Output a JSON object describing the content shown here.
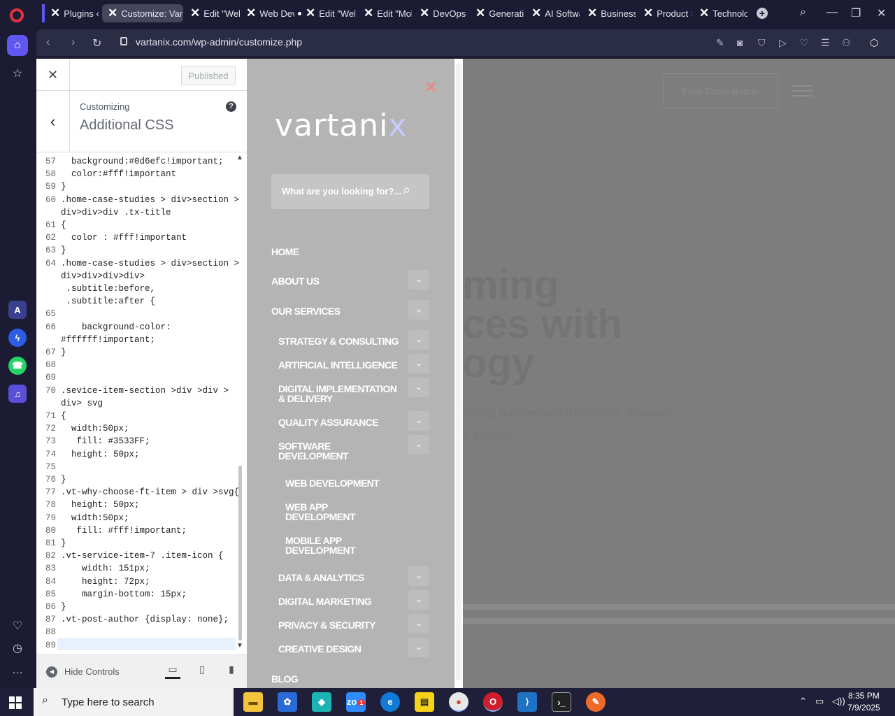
{
  "browser": {
    "tabs": [
      {
        "label": "Plugins ‹",
        "active": false
      },
      {
        "label": "Customize: Varta",
        "active": true
      },
      {
        "label": "Edit \"Web",
        "active": false
      },
      {
        "label": "Web Deve",
        "active": false
      },
      {
        "label": "Edit \"Web",
        "active": false
      },
      {
        "label": "Edit \"Mob",
        "active": false
      },
      {
        "label": "DevOps C",
        "active": false
      },
      {
        "label": "Generativ",
        "active": false
      },
      {
        "label": "AI Softwa",
        "active": false
      },
      {
        "label": "Business",
        "active": false
      },
      {
        "label": "Product S",
        "active": false
      },
      {
        "label": "Technolog",
        "active": false
      }
    ],
    "url": "vartanix.com/wp-admin/customize.php"
  },
  "customizer": {
    "published_label": "Published",
    "customizing_label": "Customizing",
    "section_title": "Additional CSS",
    "hide_controls_label": "Hide Controls",
    "code_lines": [
      {
        "n": "57",
        "t": "  background:#0d6efc!important;"
      },
      {
        "n": "58",
        "t": "  color:#fff!important"
      },
      {
        "n": "59",
        "t": "}"
      },
      {
        "n": "60",
        "t": ".home-case-studies > div>section >"
      },
      {
        "n": "",
        "t": "div>div>div .tx-title"
      },
      {
        "n": "61",
        "t": "{"
      },
      {
        "n": "62",
        "t": "  color : #fff!important"
      },
      {
        "n": "63",
        "t": "}"
      },
      {
        "n": "64",
        "t": ".home-case-studies > div>section >"
      },
      {
        "n": "",
        "t": "div>div>div>div>"
      },
      {
        "n": "",
        "t": " .subtitle:before,"
      },
      {
        "n": "",
        "t": " .subtitle:after {"
      },
      {
        "n": "65",
        "t": ""
      },
      {
        "n": "66",
        "t": "    background-color:"
      },
      {
        "n": "",
        "t": "#ffffff!important;"
      },
      {
        "n": "67",
        "t": "}"
      },
      {
        "n": "68",
        "t": ""
      },
      {
        "n": "69",
        "t": ""
      },
      {
        "n": "70",
        "t": ".sevice-item-section >div >div >"
      },
      {
        "n": "",
        "t": "div> svg"
      },
      {
        "n": "71",
        "t": "{"
      },
      {
        "n": "72",
        "t": "  width:50px;"
      },
      {
        "n": "73",
        "t": "   fill: #3533FF;"
      },
      {
        "n": "74",
        "t": "  height: 50px;"
      },
      {
        "n": "75",
        "t": ""
      },
      {
        "n": "76",
        "t": "}"
      },
      {
        "n": "77",
        "t": ".vt-why-choose-ft-item > div >svg{"
      },
      {
        "n": "78",
        "t": "  height: 50px;"
      },
      {
        "n": "79",
        "t": "  width:50px;"
      },
      {
        "n": "80",
        "t": "   fill: #fff!important;"
      },
      {
        "n": "81",
        "t": "}"
      },
      {
        "n": "82",
        "t": ".vt-service-item-7 .item-icon {"
      },
      {
        "n": "83",
        "t": "    width: 151px;"
      },
      {
        "n": "84",
        "t": "    height: 72px;"
      },
      {
        "n": "85",
        "t": "    margin-bottom: 15px;"
      },
      {
        "n": "86",
        "t": "}"
      },
      {
        "n": "87",
        "t": ".vt-post-author {display: none};"
      },
      {
        "n": "88",
        "t": ""
      },
      {
        "n": "89",
        "t": ""
      }
    ]
  },
  "preview": {
    "logo_main": "vartani",
    "logo_accent": "x",
    "search_placeholder": "What are you looking for?...",
    "free_consult_label": "Free Consultation",
    "hero_line1": "ming",
    "hero_line2": "ces with",
    "hero_line3": "ogy",
    "hero_sub1": "elping businesses transform, innovate",
    "hero_sub2": "e change.",
    "menu": [
      {
        "label": "HOME",
        "level": 0,
        "chevron": false
      },
      {
        "label": "ABOUT US",
        "level": 0,
        "chevron": true
      },
      {
        "label": "OUR SERVICES",
        "level": 0,
        "chevron": true
      },
      {
        "label": "STRATEGY & CONSULTING",
        "level": 1,
        "chevron": true
      },
      {
        "label": "ARTIFICIAL INTELLIGENCE",
        "level": 1,
        "chevron": true
      },
      {
        "label": "DIGITAL IMPLEMENTATION & DELIVERY",
        "level": 1,
        "chevron": true
      },
      {
        "label": "QUALITY ASSURANCE",
        "level": 1,
        "chevron": true
      },
      {
        "label": "SOFTWARE DEVELOPMENT",
        "level": 1,
        "chevron": true
      },
      {
        "label": "WEB DEVELOPMENT",
        "level": 2,
        "chevron": false
      },
      {
        "label": "WEB APP DEVELOPMENT",
        "level": 2,
        "chevron": false
      },
      {
        "label": "MOBILE APP DEVELOPMENT",
        "level": 2,
        "chevron": false
      },
      {
        "label": "DATA & ANALYTICS",
        "level": 1,
        "chevron": true
      },
      {
        "label": "DIGITAL MARKETING",
        "level": 1,
        "chevron": true
      },
      {
        "label": "PRIVACY & SECURITY",
        "level": 1,
        "chevron": true
      },
      {
        "label": "CREATIVE DESIGN",
        "level": 1,
        "chevron": true
      },
      {
        "label": "BLOG",
        "level": 0,
        "chevron": false
      }
    ]
  },
  "taskbar": {
    "search_placeholder": "Type here to search",
    "time": "8:35 PM",
    "date": "7/9/2025",
    "zoom_badge": "1"
  }
}
